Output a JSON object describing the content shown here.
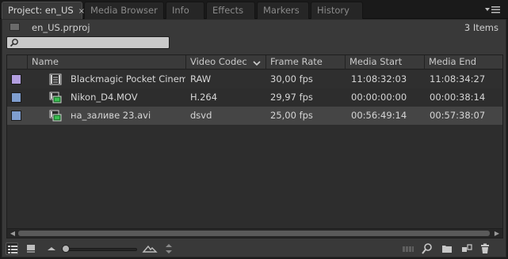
{
  "tabs": [
    {
      "label": "Project: en_US",
      "active": true
    },
    {
      "label": "Media Browser",
      "active": false
    },
    {
      "label": "Info",
      "active": false
    },
    {
      "label": "Effects",
      "active": false
    },
    {
      "label": "Markers",
      "active": false
    },
    {
      "label": "History",
      "active": false
    }
  ],
  "tab_close_glyph": "×",
  "project": {
    "file_name": "en_US.prproj",
    "item_count": "3 Items"
  },
  "search": {
    "value": "",
    "placeholder": ""
  },
  "columns": [
    "Name",
    "Video Codec",
    "Frame Rate",
    "Media Start",
    "Media End"
  ],
  "sort_column": "Video Codec",
  "rows": [
    {
      "label_color": "#b39fe0",
      "name": "Blackmagic Pocket Cinema",
      "codec": "RAW",
      "frame_rate": "30,00 fps",
      "media_start": "11:08:32:03",
      "media_end": "11:08:34:27",
      "icon": "image-sequence-icon",
      "selected": false
    },
    {
      "label_color": "#7f9ecf",
      "name": "Nikon_D4.MOV",
      "codec": "H.264",
      "frame_rate": "29,97 fps",
      "media_start": "00:00:00:00",
      "media_end": "00:00:38:14",
      "icon": "video-clip-icon",
      "selected": false
    },
    {
      "label_color": "#7f9ecf",
      "name": "на_заливе 23.avi",
      "codec": "dsvd",
      "frame_rate": "25,00 fps",
      "media_start": "00:56:49:14",
      "media_end": "00:57:38:07",
      "icon": "video-clip-icon",
      "selected": true
    }
  ],
  "thumbnail_zoom": 0.0
}
